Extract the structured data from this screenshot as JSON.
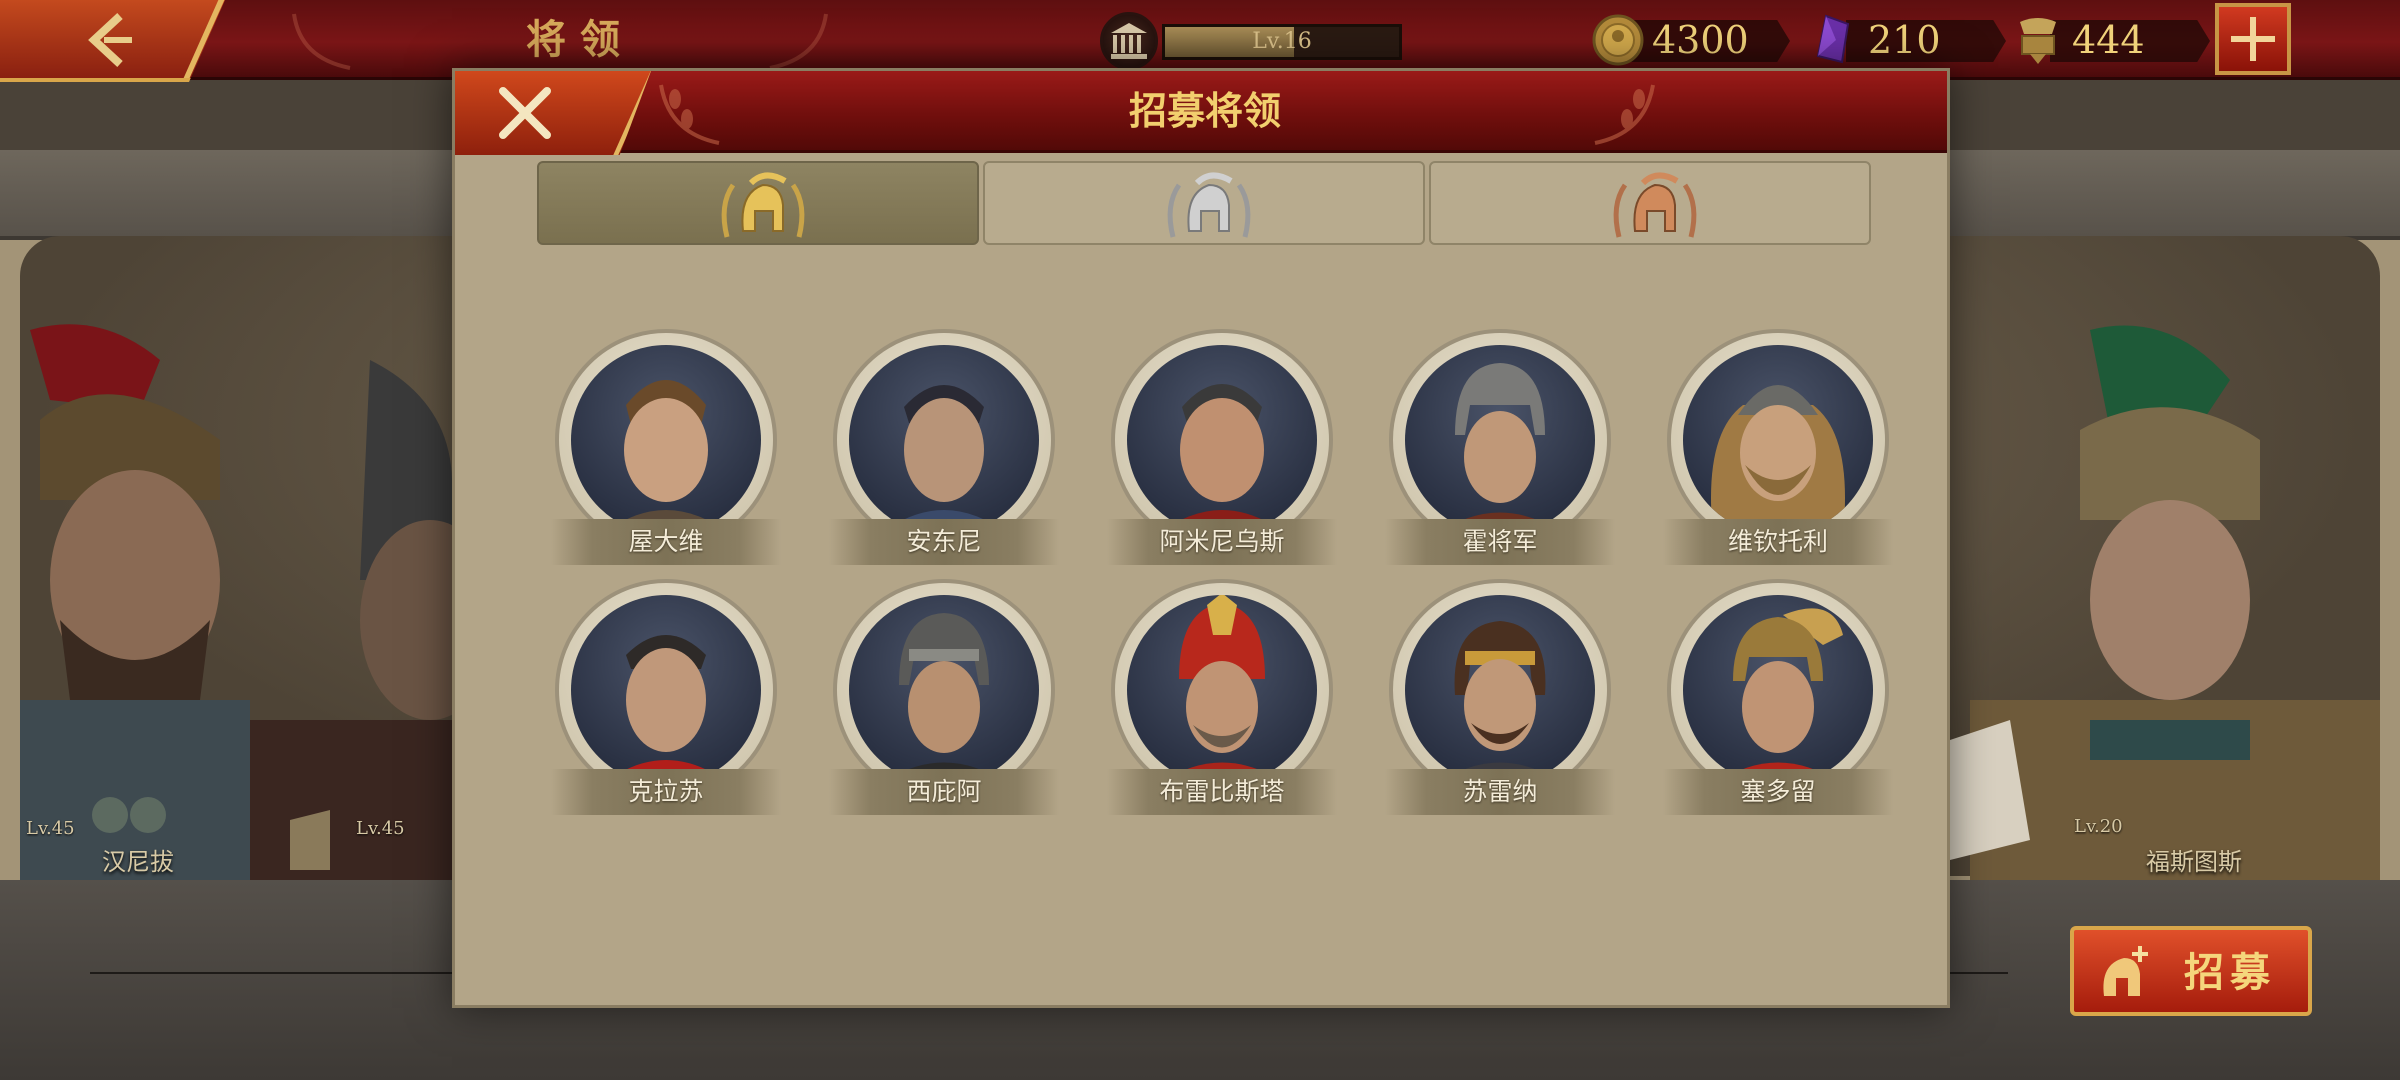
{
  "top_bar": {
    "title": "将领",
    "city_level": "Lv.16",
    "city_level_progress": 0.55,
    "resources": [
      {
        "name": "gold",
        "icon": "gold-coin-icon",
        "value": "4300"
      },
      {
        "name": "gem",
        "icon": "purple-gem-icon",
        "value": "210"
      },
      {
        "name": "spqr",
        "icon": "spqr-banner-icon",
        "value": "444"
      }
    ],
    "plus_label": "+"
  },
  "background": {
    "side_generals": [
      {
        "name": "汉尼拔",
        "level": "Lv.45"
      },
      {
        "name": "",
        "level": "Lv.45"
      },
      {
        "name": "福斯图斯",
        "level": "Lv.20"
      }
    ],
    "recruit_button": "招募"
  },
  "modal": {
    "title": "招募将领",
    "tabs": [
      {
        "icon": "gold-spartan-helmet-icon",
        "tier": "gold",
        "active": true
      },
      {
        "icon": "silver-spartan-helmet-icon",
        "tier": "silver",
        "active": false
      },
      {
        "icon": "bronze-spartan-helmet-icon",
        "tier": "bronze",
        "active": false
      }
    ],
    "generals": [
      {
        "name": "屋大维"
      },
      {
        "name": "安东尼"
      },
      {
        "name": "阿米尼乌斯"
      },
      {
        "name": "霍将军"
      },
      {
        "name": "维钦托利"
      },
      {
        "name": "克拉苏"
      },
      {
        "name": "西庇阿"
      },
      {
        "name": "布雷比斯塔"
      },
      {
        "name": "苏雷纳"
      },
      {
        "name": "塞多留"
      }
    ]
  },
  "colors": {
    "header_red": "#7a1516",
    "accent_gold": "#f2cf6e",
    "panel_parchment": "#b3a588",
    "button_orange": "#d0481c"
  }
}
